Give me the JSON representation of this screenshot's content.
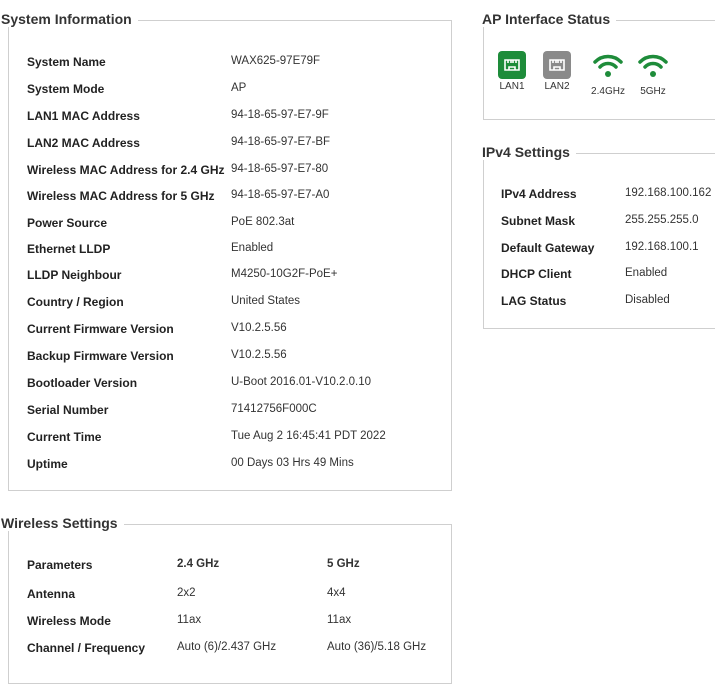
{
  "system_info": {
    "title": "System Information",
    "rows": [
      {
        "label": "System Name",
        "value": "WAX625-97E79F"
      },
      {
        "label": "System Mode",
        "value": "AP"
      },
      {
        "label": "LAN1 MAC Address",
        "value": "94-18-65-97-E7-9F"
      },
      {
        "label": "LAN2 MAC Address",
        "value": "94-18-65-97-E7-BF"
      },
      {
        "label": "Wireless MAC Address for 2.4 GHz",
        "value": "94-18-65-97-E7-80"
      },
      {
        "label": "Wireless MAC Address for 5 GHz",
        "value": "94-18-65-97-E7-A0"
      },
      {
        "label": "Power Source",
        "value": "PoE 802.3at"
      },
      {
        "label": "Ethernet LLDP",
        "value": "Enabled"
      },
      {
        "label": "LLDP Neighbour",
        "value": "M4250-10G2F-PoE+"
      },
      {
        "label": "Country / Region",
        "value": "United States"
      },
      {
        "label": "Current Firmware Version",
        "value": "V10.2.5.56"
      },
      {
        "label": "Backup Firmware Version",
        "value": "V10.2.5.56"
      },
      {
        "label": "Bootloader Version",
        "value": "U-Boot 2016.01-V10.2.0.10"
      },
      {
        "label": "Serial Number",
        "value": "71412756F000C"
      },
      {
        "label": "Current Time",
        "value": "Tue Aug 2 16:45:41 PDT 2022"
      },
      {
        "label": "Uptime",
        "value": "00 Days 03 Hrs 49 Mins"
      }
    ]
  },
  "ap_interface": {
    "title": "AP Interface Status",
    "ports": [
      {
        "label": "LAN1",
        "icon": "ethernet-port-icon",
        "status": "up",
        "color": "#1e8c3a"
      },
      {
        "label": "LAN2",
        "icon": "ethernet-port-icon",
        "status": "down",
        "color": "#8a8a8a"
      },
      {
        "label": "2.4GHz",
        "icon": "wifi-icon",
        "status": "up",
        "color": "#1e8c3a"
      },
      {
        "label": "5GHz",
        "icon": "wifi-icon",
        "status": "up",
        "color": "#1e8c3a"
      }
    ]
  },
  "ipv4": {
    "title": "IPv4 Settings",
    "rows": [
      {
        "label": "IPv4 Address",
        "value": "192.168.100.162"
      },
      {
        "label": "Subnet Mask",
        "value": "255.255.255.0"
      },
      {
        "label": "Default Gateway",
        "value": "192.168.100.1"
      },
      {
        "label": "DHCP Client",
        "value": "Enabled"
      },
      {
        "label": "LAG Status",
        "value": "Disabled"
      }
    ]
  },
  "wireless": {
    "title": "Wireless Settings",
    "headers": [
      "Parameters",
      "2.4 GHz",
      "5 GHz"
    ],
    "rows": [
      {
        "label": "Antenna",
        "v24": "2x2",
        "v5": "4x4"
      },
      {
        "label": "Wireless Mode",
        "v24": "11ax",
        "v5": "11ax"
      },
      {
        "label": "Channel / Frequency",
        "v24": "Auto (6)/2.437 GHz",
        "v5": "Auto (36)/5.18 GHz"
      }
    ]
  }
}
